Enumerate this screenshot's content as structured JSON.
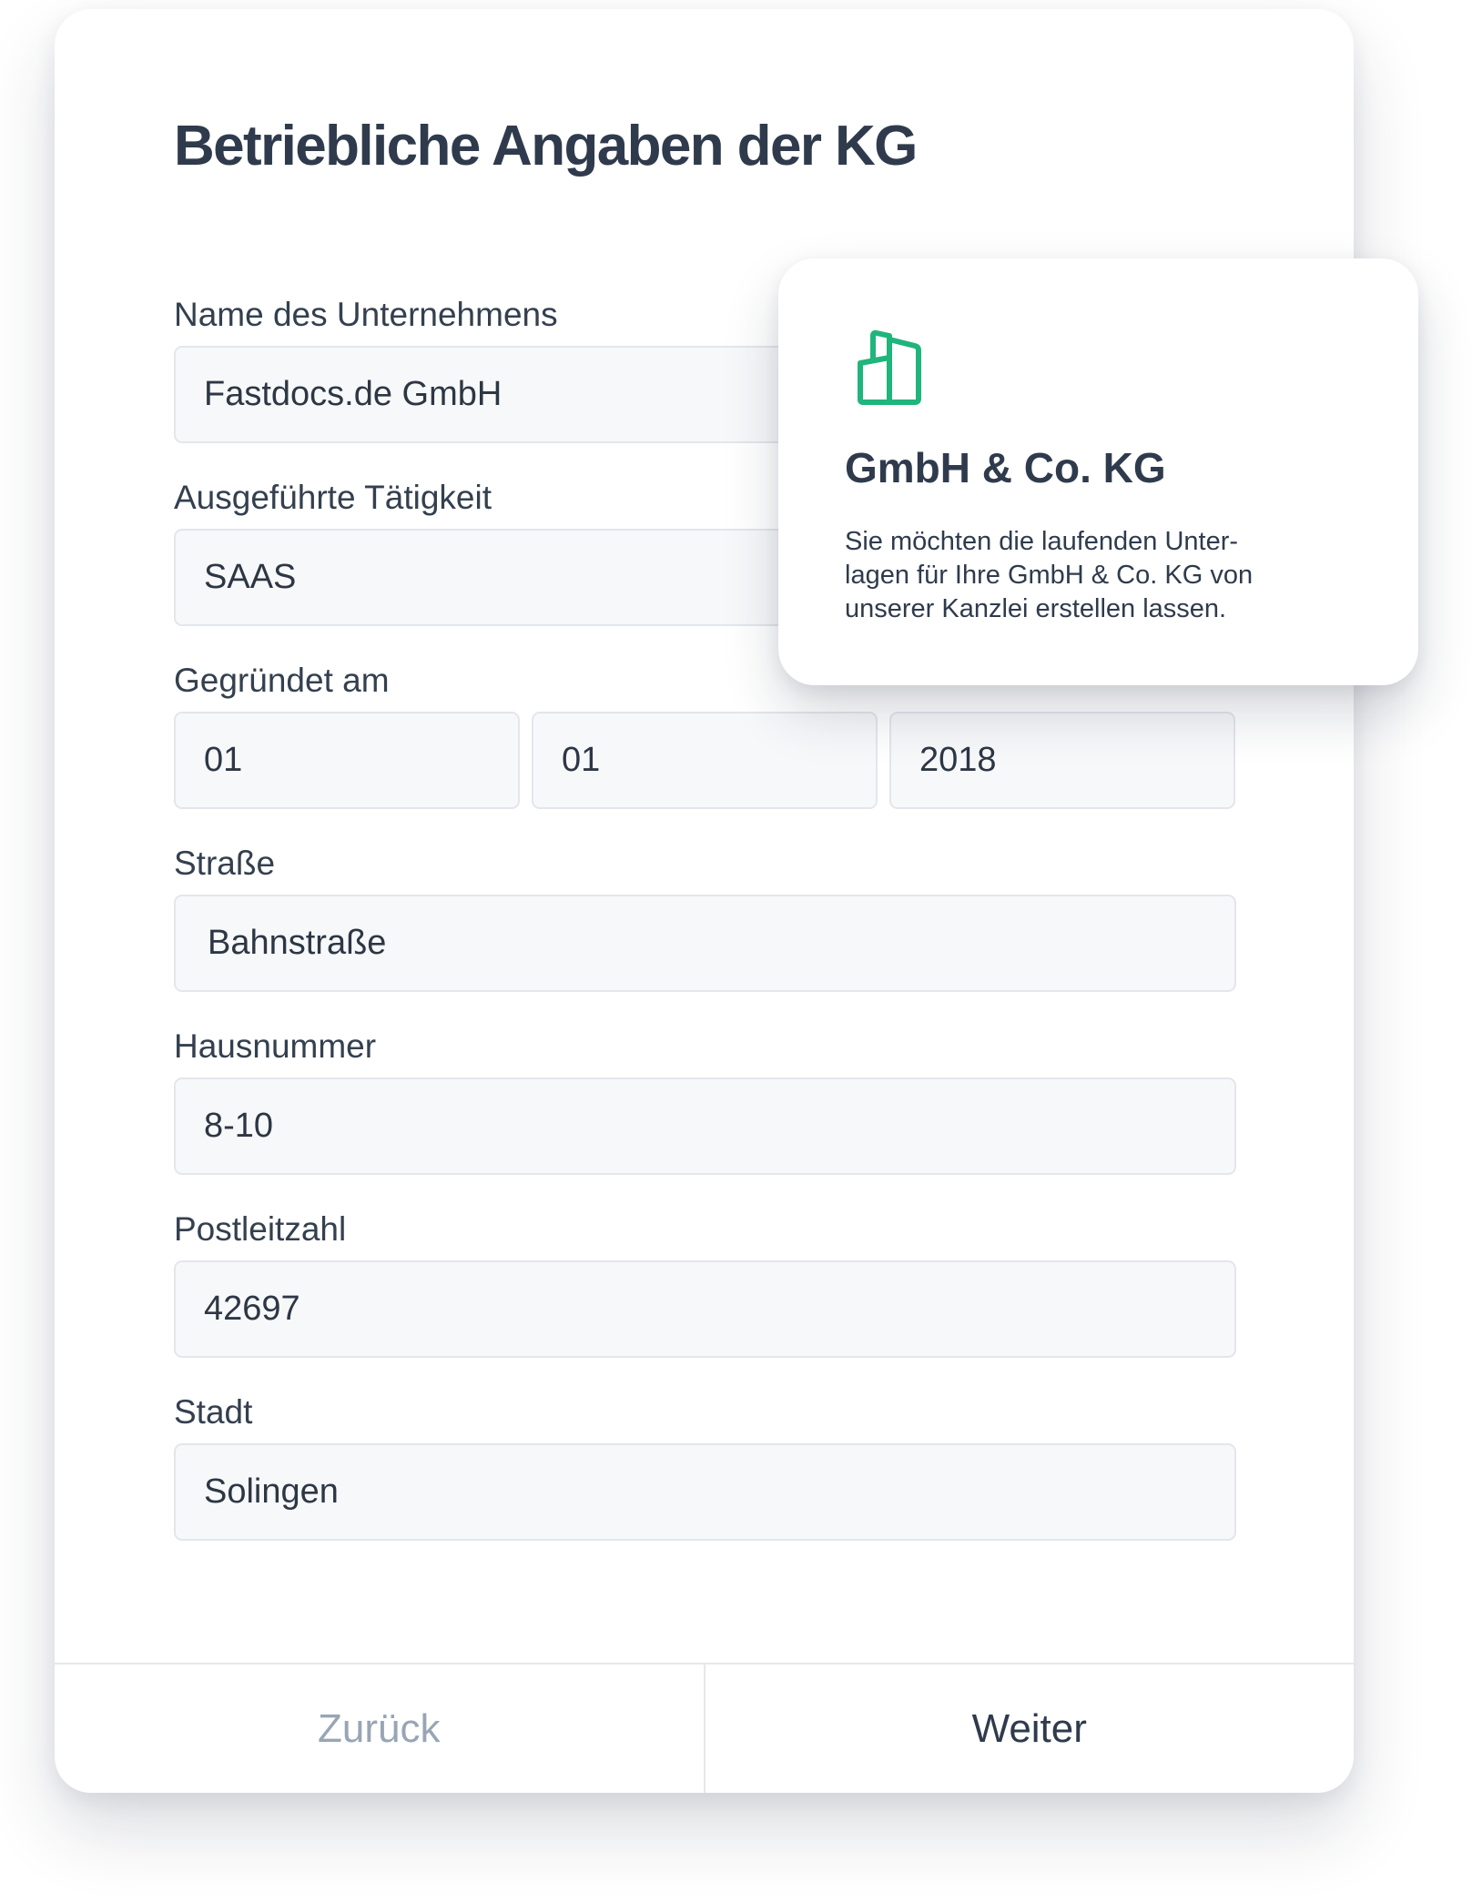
{
  "form": {
    "title": "Betriebliche Angaben der KG",
    "fields": {
      "company_name": {
        "label": "Name des Unternehmens",
        "value": "Fastdocs.de GmbH"
      },
      "activity": {
        "label": "Ausgeführte Tätigkeit",
        "value": "SAAS"
      },
      "founded": {
        "label": "Gegründet am",
        "day": "01",
        "month": "01",
        "year": "2018"
      },
      "street": {
        "label": "Straße",
        "value": "Bahnstraße"
      },
      "house_number": {
        "label": "Hausnummer",
        "value": "8-10"
      },
      "postal_code": {
        "label": "Postleitzahl",
        "value": "42697"
      },
      "city": {
        "label": "Stadt",
        "value": "Solingen"
      }
    },
    "footer": {
      "back_label": "Zurück",
      "next_label": "Weiter"
    }
  },
  "info_card": {
    "icon": "buildings-icon",
    "accent_color": "#1fb57c",
    "title": "GmbH & Co. KG",
    "text_lines": [
      "Sie möchten die laufenden Unter-",
      "lagen für Ihre GmbH & Co. KG von",
      "unserer Kanzlei erstellen lassen."
    ]
  }
}
